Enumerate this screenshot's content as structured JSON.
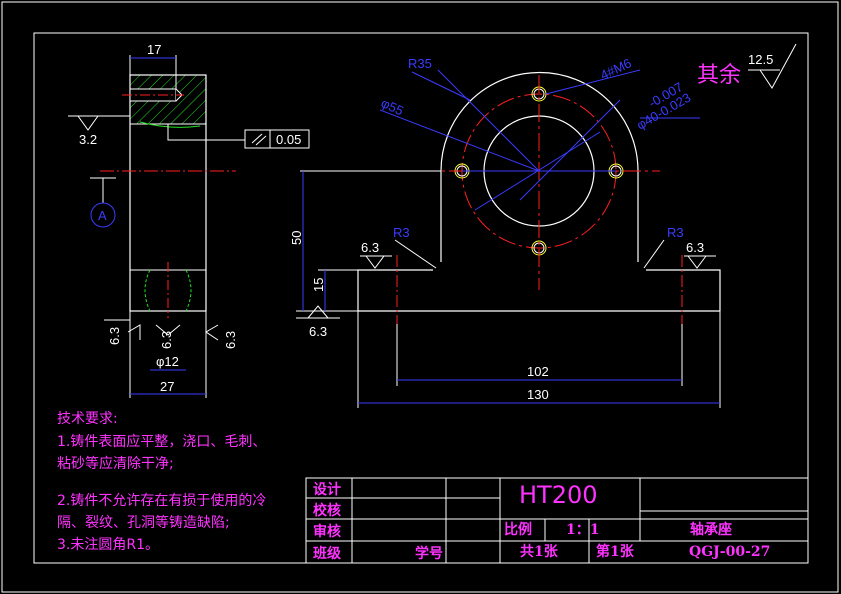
{
  "drawing_title": "轴承座",
  "material": "HT200",
  "drawing_number": "QGJ-00-27",
  "scale_label": "比例",
  "scale_value": "1：1",
  "sheet_total": "共1张",
  "sheet_index": "第1张",
  "title_block": {
    "design": "设计",
    "check": "校核",
    "review": "审核",
    "class": "班级",
    "student_no": "学号"
  },
  "surface_finish": {
    "other_label": "其余",
    "other_value": "12.5"
  },
  "tech_requirements": {
    "heading": "技术要求:",
    "items": [
      "1.铸件表面应平整，浇口、毛刺、",
      "粘砂等应清除干净;",
      "2.铸件不允许存在有损于使用的冷",
      "隔、裂纹、孔洞等铸造缺陷;",
      "3.未注圆角R1。"
    ]
  },
  "dimensions": {
    "side_width_top": "17",
    "side_width_bottom": "27",
    "hole_dia": "φ12",
    "roughness_side_left": "3.2",
    "roughness_a": "6.3",
    "roughness_b": "6.3",
    "roughness_c": "6.3",
    "roughness_d": "6.3",
    "roughness_e": "6.3",
    "roughness_f": "6.3",
    "tolerance_frame": "0.05",
    "datum": "A",
    "height_total": "50",
    "height_base": "15",
    "r_outer": "R35",
    "phi_bolt": "φ55",
    "holes": "4#M6",
    "bore_upper_dev": "-0.007",
    "bore": "φ40-0.023",
    "fillet_left": "R3",
    "fillet_right": "R3",
    "hole_spacing": "102",
    "base_length": "130"
  },
  "colors": {
    "outline": "#ffffff",
    "center": "#ff2020",
    "dim": "#3b3bff",
    "hatch": "#22dd22",
    "text": "#ff33ff",
    "yellow": "#ffff33",
    "cyan": "#00e5ff"
  }
}
